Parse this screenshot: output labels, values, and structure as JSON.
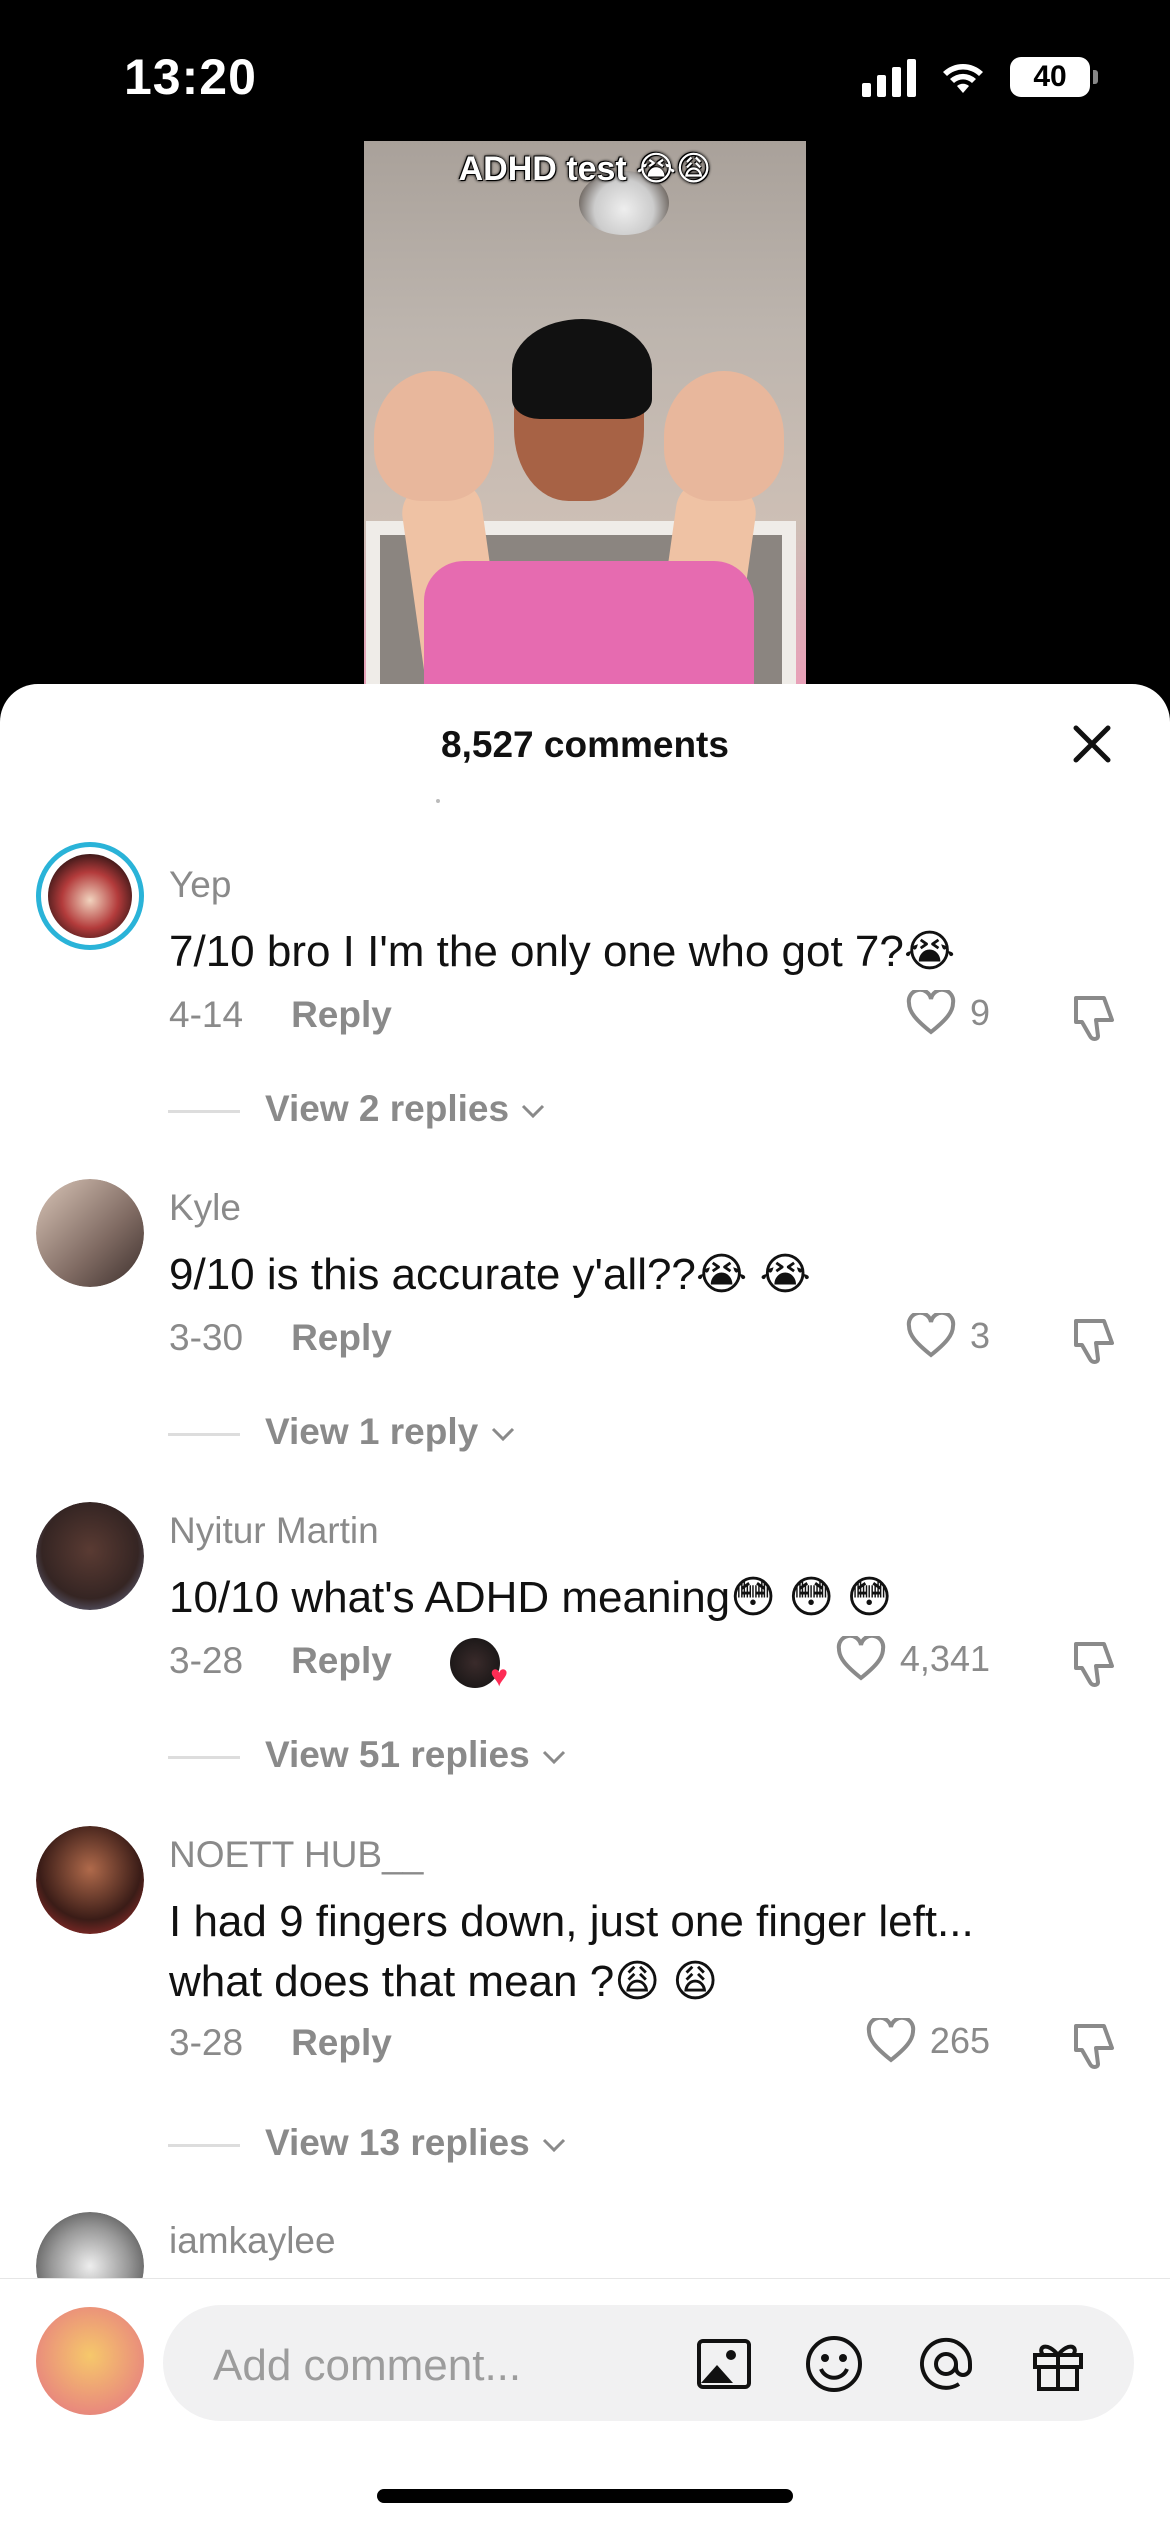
{
  "status": {
    "time": "13:20",
    "battery": "40"
  },
  "video": {
    "caption": "ADHD test 😭😩"
  },
  "comments_sheet": {
    "title": "8,527 comments",
    "comments": [
      {
        "name": "Yep",
        "text": "7/10 bro I I'm the only one who got 7?",
        "emojis": "😭",
        "date": "4-14",
        "reply_label": "Reply",
        "likes": "9",
        "view_replies": "View 2 replies"
      },
      {
        "name": "Kyle",
        "text": "9/10 is this accurate y'all??",
        "emojis": "😭 😭",
        "date": "3-30",
        "reply_label": "Reply",
        "likes": "3",
        "view_replies": "View 1 reply"
      },
      {
        "name": "Nyitur Martin",
        "text": "10/10 what's ADHD meaning",
        "emojis": "😳 😳 😳",
        "date": "3-28",
        "reply_label": "Reply",
        "likes": "4,341",
        "view_replies": "View 51 replies"
      },
      {
        "name": "NOETT HUB__",
        "text": "I had 9 fingers down, just one finger left... what does that mean ?",
        "emojis": "😩 😩",
        "date": "3-28",
        "reply_label": "Reply",
        "likes": "265",
        "view_replies": "View 13 replies"
      },
      {
        "name": "iamkaylee"
      }
    ]
  },
  "composer": {
    "placeholder": "Add comment..."
  },
  "colors": {
    "accent_ring": "#2ab3d8",
    "heart": "#fe2c55",
    "muted": "#8a8a8a"
  },
  "icons": [
    "signal-icon",
    "wifi-icon",
    "close-icon",
    "heart-icon",
    "dislike-icon",
    "chevron-down-icon",
    "image-icon",
    "emoji-icon",
    "mention-icon",
    "gift-icon"
  ]
}
